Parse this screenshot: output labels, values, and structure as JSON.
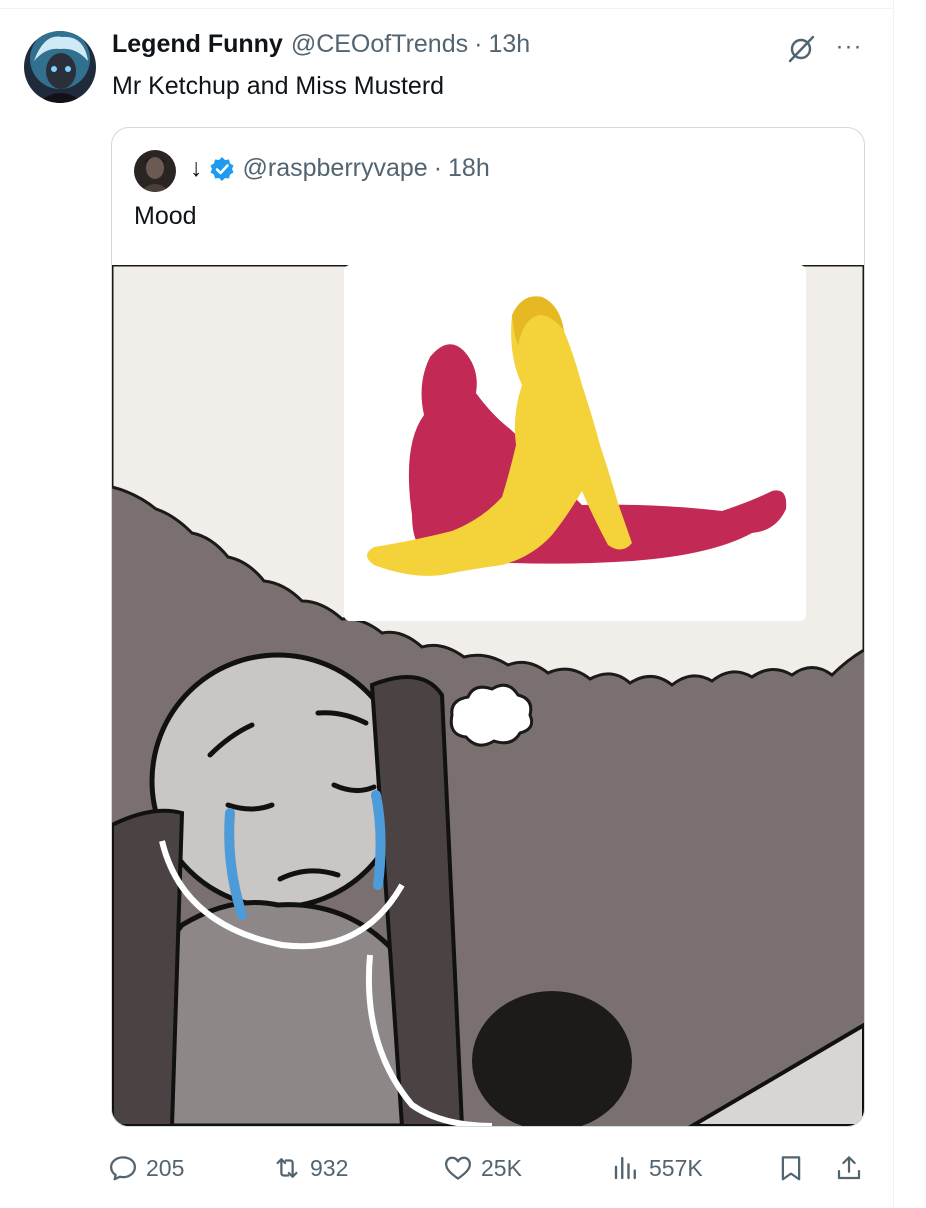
{
  "tweet": {
    "author_name": "Legend Funny",
    "author_handle": "@CEOofTrends",
    "separator": "·",
    "time": "13h",
    "text": "Mr Ketchup and Miss Musterd",
    "more": "···"
  },
  "quote": {
    "author_name": "↓",
    "author_handle": "@raspberryvape",
    "separator": "·",
    "time": "18h",
    "text": "Mood"
  },
  "metrics": {
    "replies": "205",
    "retweets": "932",
    "likes": "25K",
    "views": "557K"
  },
  "colors": {
    "text_primary": "#0f1419",
    "text_secondary": "#536471",
    "verified_blue": "#1d9bf0",
    "border": "#cfd9de"
  },
  "icons": [
    "reply-icon",
    "retweet-icon",
    "like-icon",
    "views-icon",
    "bookmark-icon",
    "share-icon",
    "grok-icon",
    "more-icon",
    "verified-icon"
  ]
}
